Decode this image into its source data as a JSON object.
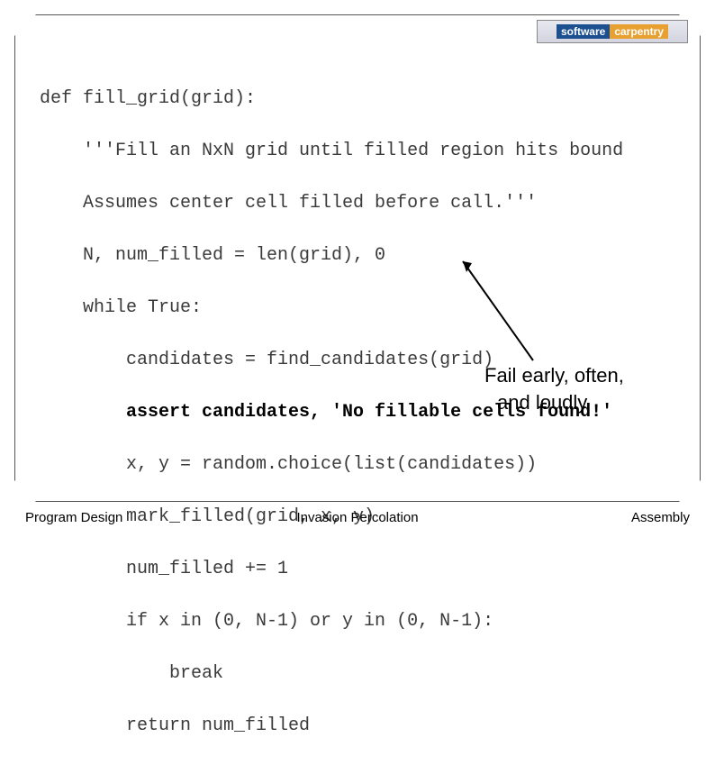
{
  "logo": {
    "left": "software",
    "right": "carpentry"
  },
  "code": {
    "l0": "def fill_grid(grid):",
    "l1": "    '''Fill an NxN grid until filled region hits bound",
    "l2": "    Assumes center cell filled before call.'''",
    "l3": "    N, num_filled = len(grid), 0",
    "l4": "    while True:",
    "l5": "        candidates = find_candidates(grid)",
    "l6": "        assert candidates, 'No fillable cells found!'",
    "l7": "        x, y = random.choice(list(candidates))",
    "l8": "        mark_filled(grid, x, y)",
    "l9": "        num_filled += 1",
    "l10": "        if x in (0, N-1) or y in (0, N-1):",
    "l11": "            break",
    "l12": "        return num_filled"
  },
  "annotation": {
    "line1": "Fail early, often,",
    "line2": "and loudly"
  },
  "footer": {
    "left": "Program Design",
    "center": "Invasion Percolation",
    "right": "Assembly"
  }
}
